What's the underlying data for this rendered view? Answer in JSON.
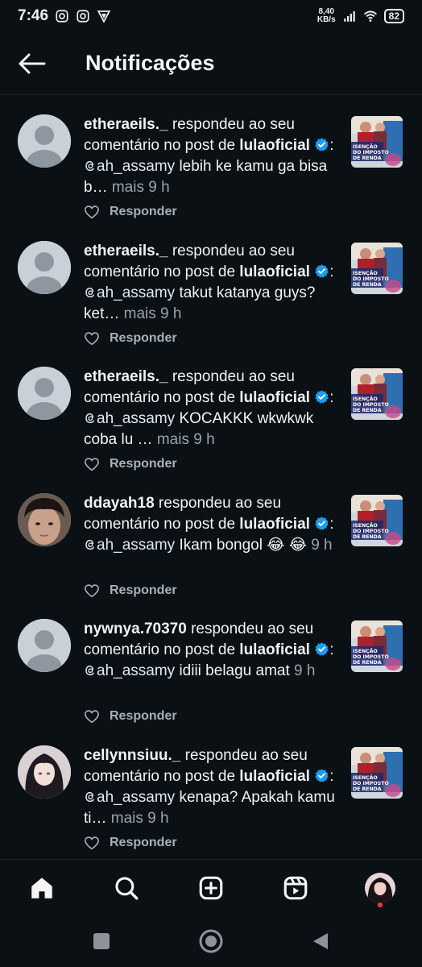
{
  "status": {
    "time": "7:46",
    "net_speed_value": "8,40",
    "net_speed_unit": "KB/s",
    "battery": "82"
  },
  "header": {
    "title": "Notificações"
  },
  "notifications": [
    {
      "username": "etheraeils._",
      "action": " respondeu ao seu comentário no post de ",
      "owner": "lulaoficial",
      "mention": "ah_assamy",
      "text": " lebih ke kamu ga bisa b…",
      "time": " mais 9 h",
      "reply_label": "Responder",
      "avatar": "default"
    },
    {
      "username": "etheraeils._",
      "action": " respondeu ao seu comentário no post de ",
      "owner": "lulaoficial",
      "mention": "ah_assamy",
      "text": " takut katanya guys? ket…",
      "time": " mais 9 h",
      "reply_label": "Responder",
      "avatar": "default"
    },
    {
      "username": "etheraeils._",
      "action": " respondeu ao seu comentário no post de ",
      "owner": "lulaoficial",
      "mention": "ah_assamy",
      "text": " KOCAKKK wkwkwk coba lu …",
      "time": " mais 9 h",
      "reply_label": "Responder",
      "avatar": "default"
    },
    {
      "username": "ddayah18",
      "action": " respondeu ao seu comentário no post de ",
      "owner": "lulaoficial",
      "mention": "ah_assamy",
      "text": " Ikam bongol 😂 😂",
      "time": " 9 h",
      "reply_label": "Responder",
      "avatar": "photo-male"
    },
    {
      "username": "nywnya.70370",
      "action": " respondeu ao seu comentário no post de ",
      "owner": "lulaoficial",
      "mention": "ah_assamy",
      "text": " idiii belagu amat",
      "time": " 9 h",
      "reply_label": "Responder",
      "avatar": "default"
    },
    {
      "username": "cellynnsiuu._",
      "action": " respondeu ao seu comentário no post de ",
      "owner": "lulaoficial",
      "mention": "ah_assamy",
      "text": " kenapa? Apakah kamu ti…",
      "time": " mais 9 h",
      "reply_label": "Responder",
      "avatar": "photo-anime"
    }
  ],
  "post_thumbnail": {
    "line1": "ISENÇÃO",
    "line2": "DO IMPOSTO",
    "line3": "DE RENDA"
  },
  "colors": {
    "background": "#0b1014",
    "verified": "#1d9bf0",
    "notification_dot": "#ff3040"
  },
  "icons": {
    "tabs": [
      "home-icon",
      "search-icon",
      "create-icon",
      "reels-icon",
      "profile-avatar"
    ],
    "system": [
      "recents-icon",
      "home-circle-icon",
      "back-triangle-icon"
    ]
  }
}
